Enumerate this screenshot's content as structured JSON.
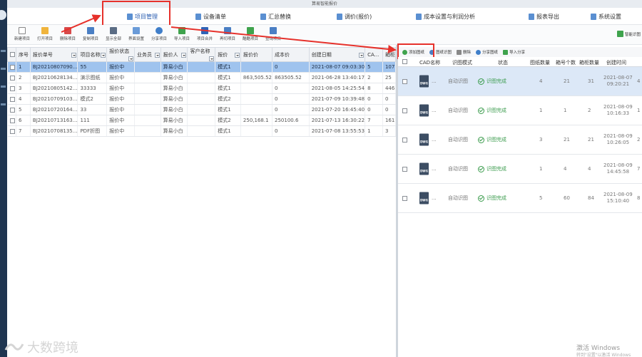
{
  "window": {
    "title": "算易智能报价"
  },
  "menu": [
    {
      "label": "项目管理",
      "active": true
    },
    {
      "label": "设备清单"
    },
    {
      "label": "汇总替换"
    },
    {
      "label": "调价(报价)"
    },
    {
      "label": "成本设置与利润分析"
    },
    {
      "label": "报表导出"
    },
    {
      "label": "系统设置"
    }
  ],
  "toolbar": {
    "buttons": [
      "新建项目",
      "打开项目",
      "删除项目",
      "复制项目",
      "显示全部",
      "界面设置",
      "分享项目",
      "导入项目",
      "项目合并",
      "再切项目",
      "酷酷项目",
      "查询项目"
    ],
    "smart_label": "智能识图"
  },
  "left_table": {
    "columns": [
      "序号",
      "报价单号",
      "项目名称",
      "报价状态",
      "业务员",
      "报价人",
      "客户名称",
      "报价",
      "报价价",
      "成本价",
      "创建日期",
      "CA...",
      "箱柜"
    ],
    "rows": [
      {
        "no": "1",
        "code": "BJ20210807090...",
        "name": "55",
        "status": "报价中",
        "sales": "",
        "quoter": "算易小白",
        "customer": "",
        "mode": "模式1",
        "quote": "",
        "cost": "0",
        "date": "2021-08-07 09:03:30",
        "ca": "5",
        "box": "107"
      },
      {
        "no": "2",
        "code": "BJ20210628134...",
        "name": "演示图纸",
        "status": "报价中",
        "sales": "",
        "quoter": "算易小白",
        "customer": "",
        "mode": "模式1",
        "quote": "863,505.52",
        "cost": "863505.52",
        "date": "2021-06-28 13:40:17",
        "ca": "2",
        "box": "25"
      },
      {
        "no": "3",
        "code": "BJ20210805142...",
        "name": "33333",
        "status": "报价中",
        "sales": "",
        "quoter": "算易小白",
        "customer": "",
        "mode": "模式1",
        "quote": "",
        "cost": "0",
        "date": "2021-08-05 14:25:54",
        "ca": "8",
        "box": "446"
      },
      {
        "no": "4",
        "code": "BJ20210709103...",
        "name": "模式2",
        "status": "报价中",
        "sales": "",
        "quoter": "算易小白",
        "customer": "",
        "mode": "模式2",
        "quote": "",
        "cost": "0",
        "date": "2021-07-09 10:39:48",
        "ca": "0",
        "box": "0"
      },
      {
        "no": "5",
        "code": "BJ20210720164...",
        "name": "33",
        "status": "报价中",
        "sales": "",
        "quoter": "算易小白",
        "customer": "",
        "mode": "模式1",
        "quote": "",
        "cost": "0",
        "date": "2021-07-20 16:45:40",
        "ca": "0",
        "box": "0"
      },
      {
        "no": "6",
        "code": "BJ20210713163...",
        "name": "111",
        "status": "报价中",
        "sales": "",
        "quoter": "算易小白",
        "customer": "",
        "mode": "模式2",
        "quote": "250,168.1",
        "cost": "250100.6",
        "date": "2021-07-13 16:30:22",
        "ca": "7",
        "box": "161"
      },
      {
        "no": "7",
        "code": "BJ20210708135...",
        "name": "PDF折图",
        "status": "报价中",
        "sales": "",
        "quoter": "算易小白",
        "customer": "",
        "mode": "模式1",
        "quote": "",
        "cost": "0",
        "date": "2021-07-08 13:55:53",
        "ca": "1",
        "box": "3"
      }
    ]
  },
  "right_toolbar": {
    "buttons": [
      "添加图纸",
      "图纸识图",
      "删除",
      "分享图纸",
      "导入分享"
    ]
  },
  "right_table": {
    "columns": [
      "CAD名称",
      "识图模式",
      "状态",
      "图纸数量",
      "箱号个数",
      "箱柜数量",
      "创建时间"
    ],
    "rows": [
      {
        "name": "...",
        "mode": "自动识图",
        "status": "识图完成",
        "pages": "4",
        "box_no": "21",
        "box_qty": "31",
        "date": "2021-08-07",
        "time": "09:20:21",
        "extra": "4"
      },
      {
        "name": "...",
        "mode": "自动识图",
        "status": "识图完成",
        "pages": "1",
        "box_no": "1",
        "box_qty": "2",
        "date": "2021-08-09",
        "time": "10:16:33",
        "extra": "1"
      },
      {
        "name": "...",
        "mode": "自动识图",
        "status": "识图完成",
        "pages": "3",
        "box_no": "21",
        "box_qty": "21",
        "date": "2021-08-09",
        "time": "10:26:05",
        "extra": "2"
      },
      {
        "name": "...",
        "mode": "自动识图",
        "status": "识图完成",
        "pages": "1",
        "box_no": "4",
        "box_qty": "4",
        "date": "2021-08-09",
        "time": "14:45:58",
        "extra": "7"
      },
      {
        "name": "...",
        "mode": "自动识图",
        "status": "识图完成",
        "pages": "5",
        "box_no": "60",
        "box_qty": "84",
        "date": "2021-08-09",
        "time": "15:10:40",
        "extra": "8"
      }
    ],
    "file_icon_label": "DWG"
  },
  "watermark": {
    "text": "大数跨境"
  },
  "windows_activation": {
    "line1": "激活 Windows",
    "line2": "转到\"设置\"以激活 Windows"
  },
  "colors": {
    "highlight": "#e6312b",
    "selected_row": "#9fc3ee",
    "status_ok": "#3a9b4c",
    "sidebar": "#1f3550"
  }
}
